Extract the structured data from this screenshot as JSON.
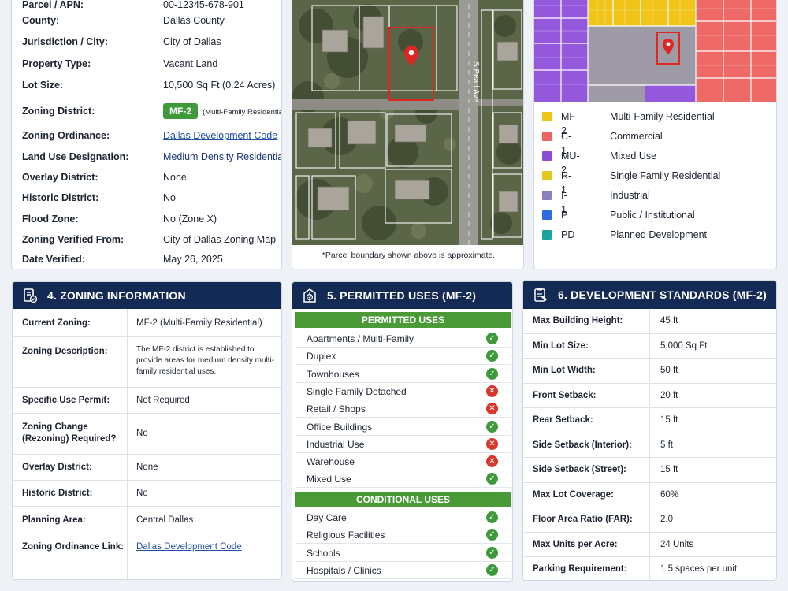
{
  "details": {
    "rows": [
      {
        "label": "Parcel / APN:",
        "value": "00-12345-678-901"
      },
      {
        "label": "County:",
        "value": "Dallas County"
      },
      {
        "label": "Jurisdiction / City:",
        "value": "City of Dallas"
      },
      {
        "label": "Property Type:",
        "value": "Vacant Land"
      },
      {
        "label": "Lot Size:",
        "value": "10,500 Sq Ft (0.24 Acres)"
      },
      {
        "label": "Zoning District:",
        "badge": "MF-2",
        "value": "(Multi-Family Residential)"
      },
      {
        "label": "Zoning Ordinance:",
        "value": "Dallas Development Code"
      },
      {
        "label": "Land Use Designation:",
        "value": "Medium Density Residential"
      },
      {
        "label": "Overlay District:",
        "value": "None"
      },
      {
        "label": "Historic District:",
        "value": "No"
      },
      {
        "label": "Flood Zone:",
        "value": "No (Zone X)"
      },
      {
        "label": "Zoning Verified From:",
        "value": "City of Dallas Zoning Map"
      },
      {
        "label": "Date Verified:",
        "value": "May 26, 2025"
      }
    ]
  },
  "aerial": {
    "street": "S Pearl Ave",
    "caption": "*Parcel boundary shown above is approximate."
  },
  "legend": [
    {
      "code": "MF-2",
      "name": "Multi-Family Residential",
      "color": "#f2c418"
    },
    {
      "code": "C-1",
      "name": "Commercial",
      "color": "#ee6461"
    },
    {
      "code": "MU-2",
      "name": "Mixed Use",
      "color": "#8b4fd1"
    },
    {
      "code": "R-1",
      "name": "Single Family Residential",
      "color": "#e3c81e"
    },
    {
      "code": "I-1",
      "name": "Industrial",
      "color": "#8c7fc0"
    },
    {
      "code": "P",
      "name": "Public / Institutional",
      "color": "#2c6be0"
    },
    {
      "code": "PD",
      "name": "Planned Development",
      "color": "#1ba39c"
    }
  ],
  "zoning_info": {
    "title": "4. ZONING INFORMATION",
    "rows": [
      {
        "label": "Current Zoning:",
        "value": "MF-2 (Multi-Family Residential)"
      },
      {
        "label": "Zoning Description:",
        "value": "The MF-2 district is established to provide areas for medium density multi-family residential uses."
      },
      {
        "label": "Specific Use Permit:",
        "value": "Not Required"
      },
      {
        "label": "Zoning Change (Rezoning) Required?",
        "value": "No"
      },
      {
        "label": "Overlay District:",
        "value": "None"
      },
      {
        "label": "Historic District:",
        "value": "No"
      },
      {
        "label": "Planning Area:",
        "value": "Central Dallas"
      },
      {
        "label": "Zoning Ordinance Link:",
        "value": "Dallas Development Code"
      }
    ]
  },
  "permitted_uses": {
    "title": "5. PERMITTED USES (MF-2)",
    "permitted_label": "PERMITTED USES",
    "conditional_label": "CONDITIONAL USES",
    "permitted": [
      {
        "name": "Apartments / Multi-Family",
        "status": "allowed"
      },
      {
        "name": "Duplex",
        "status": "allowed"
      },
      {
        "name": "Townhouses",
        "status": "allowed"
      },
      {
        "name": "Single Family Detached",
        "status": "not-allowed"
      },
      {
        "name": "Retail / Shops",
        "status": "not-allowed"
      },
      {
        "name": "Office Buildings",
        "status": "allowed"
      },
      {
        "name": "Industrial Use",
        "status": "not-allowed"
      },
      {
        "name": "Warehouse",
        "status": "not-allowed"
      },
      {
        "name": "Mixed Use",
        "status": "allowed"
      }
    ],
    "conditional": [
      {
        "name": "Day Care",
        "status": "allowed"
      },
      {
        "name": "Religious Facilities",
        "status": "allowed"
      },
      {
        "name": "Schools",
        "status": "allowed"
      },
      {
        "name": "Hospitals / Clinics",
        "status": "allowed"
      }
    ]
  },
  "dev_standards": {
    "title": "6. DEVELOPMENT STANDARDS (MF-2)",
    "rows": [
      {
        "label": "Max Building Height:",
        "value": "45 ft"
      },
      {
        "label": "Min Lot Size:",
        "value": "5,000 Sq Ft"
      },
      {
        "label": "Min Lot Width:",
        "value": "50 ft"
      },
      {
        "label": "Front Setback:",
        "value": "20 ft"
      },
      {
        "label": "Rear Setback:",
        "value": "15 ft"
      },
      {
        "label": "Side Setback (Interior):",
        "value": "5 ft"
      },
      {
        "label": "Side Setback (Street):",
        "value": "15 ft"
      },
      {
        "label": "Max Lot Coverage:",
        "value": "60%"
      },
      {
        "label": "Floor Area Ratio (FAR):",
        "value": "2.0"
      },
      {
        "label": "Max Units per Acre:",
        "value": "24 Units"
      },
      {
        "label": "Parking Requirement:",
        "value": "1.5 spaces per unit"
      }
    ]
  }
}
